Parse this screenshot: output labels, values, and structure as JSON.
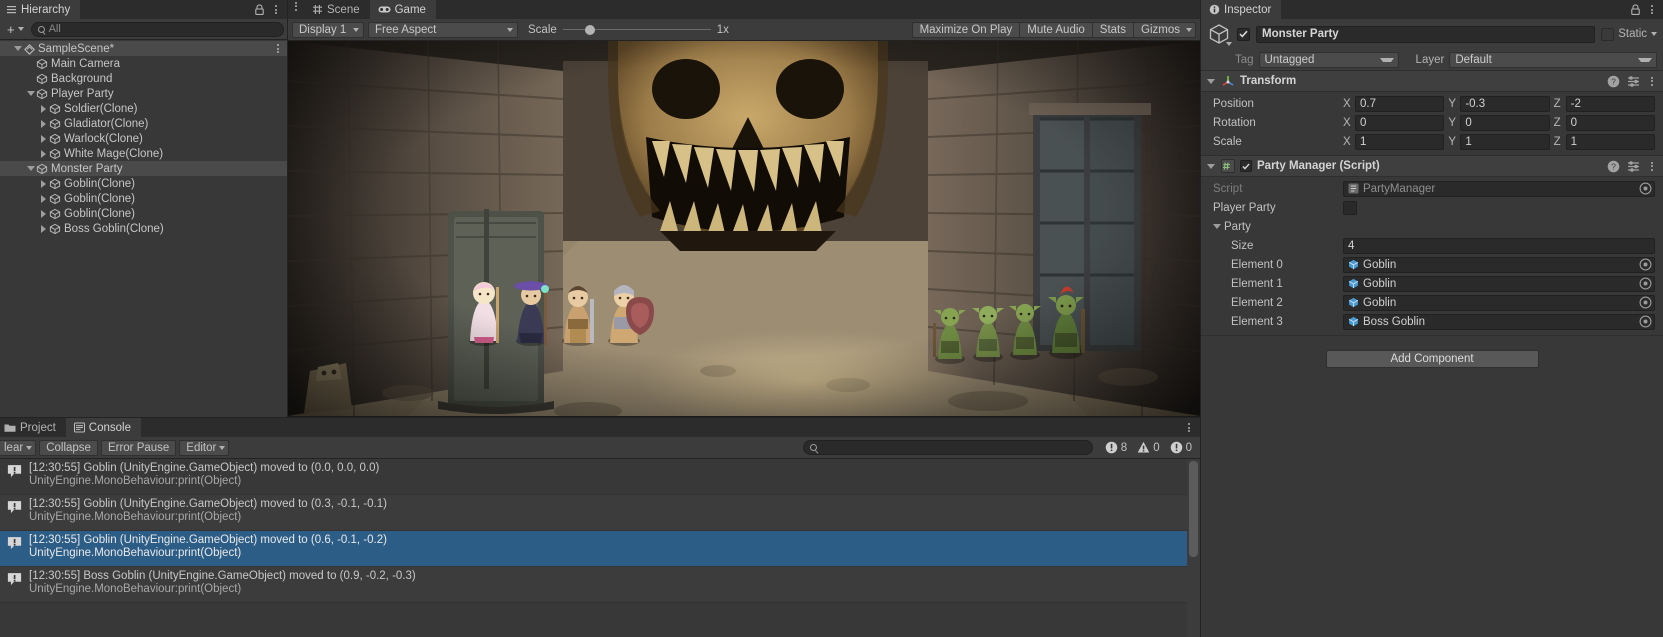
{
  "hierarchy": {
    "tab_label": "Hierarchy",
    "lock_icon": "lock-icon",
    "menu_icon": "kebab-menu-icon",
    "create_label": "+",
    "search_placeholder": "All",
    "search_value": "",
    "items": [
      {
        "label": "SampleScene*",
        "depth": 0,
        "icon": "unity-scene-icon",
        "expanded": true,
        "has_children": true,
        "selected": false,
        "has_menu": true
      },
      {
        "label": "Main Camera",
        "depth": 1,
        "icon": "gameobject-cube-icon",
        "expanded": null,
        "has_children": false,
        "selected": false,
        "has_menu": false
      },
      {
        "label": "Background",
        "depth": 1,
        "icon": "gameobject-cube-icon",
        "expanded": null,
        "has_children": false,
        "selected": false,
        "has_menu": false
      },
      {
        "label": "Player Party",
        "depth": 1,
        "icon": "gameobject-cube-icon",
        "expanded": true,
        "has_children": true,
        "selected": false,
        "has_menu": false
      },
      {
        "label": "Soldier(Clone)",
        "depth": 2,
        "icon": "gameobject-cube-icon",
        "expanded": false,
        "has_children": true,
        "selected": false,
        "has_menu": false
      },
      {
        "label": "Gladiator(Clone)",
        "depth": 2,
        "icon": "gameobject-cube-icon",
        "expanded": false,
        "has_children": true,
        "selected": false,
        "has_menu": false
      },
      {
        "label": "Warlock(Clone)",
        "depth": 2,
        "icon": "gameobject-cube-icon",
        "expanded": false,
        "has_children": true,
        "selected": false,
        "has_menu": false
      },
      {
        "label": "White Mage(Clone)",
        "depth": 2,
        "icon": "gameobject-cube-icon",
        "expanded": false,
        "has_children": true,
        "selected": false,
        "has_menu": false
      },
      {
        "label": "Monster Party",
        "depth": 1,
        "icon": "gameobject-cube-icon",
        "expanded": true,
        "has_children": true,
        "selected": true,
        "has_menu": false
      },
      {
        "label": "Goblin(Clone)",
        "depth": 2,
        "icon": "gameobject-cube-icon",
        "expanded": false,
        "has_children": true,
        "selected": false,
        "has_menu": false
      },
      {
        "label": "Goblin(Clone)",
        "depth": 2,
        "icon": "gameobject-cube-icon",
        "expanded": false,
        "has_children": true,
        "selected": false,
        "has_menu": false
      },
      {
        "label": "Goblin(Clone)",
        "depth": 2,
        "icon": "gameobject-cube-icon",
        "expanded": false,
        "has_children": true,
        "selected": false,
        "has_menu": false
      },
      {
        "label": "Boss Goblin(Clone)",
        "depth": 2,
        "icon": "gameobject-cube-icon",
        "expanded": false,
        "has_children": true,
        "selected": false,
        "has_menu": false
      }
    ]
  },
  "center": {
    "tabs": [
      {
        "label": "Scene",
        "icon": "scene-grid-icon",
        "active": false
      },
      {
        "label": "Game",
        "icon": "gamepad-icon",
        "active": true
      }
    ],
    "menu_icon": "kebab-menu-icon",
    "toolbar": {
      "display": "Display 1",
      "aspect": "Free Aspect",
      "scale_label": "Scale",
      "scale_value": "1x",
      "maximize_on_play": "Maximize On Play",
      "mute_audio": "Mute Audio",
      "stats": "Stats",
      "gizmos": "Gizmos"
    }
  },
  "inspector": {
    "tab_label": "Inspector",
    "info_icon": "info-icon",
    "lock_icon": "lock-icon",
    "menu_icon": "kebab-menu-icon",
    "object_name": "Monster Party",
    "enabled": true,
    "static_label": "Static",
    "tag_label": "Tag",
    "tag_value": "Untagged",
    "layer_label": "Layer",
    "layer_value": "Default",
    "transform": {
      "title": "Transform",
      "icon": "transform-axis-icon",
      "rows": [
        {
          "name": "Position",
          "x": "0.7",
          "y": "-0.3",
          "z": "-2"
        },
        {
          "name": "Rotation",
          "x": "0",
          "y": "0",
          "z": "0"
        },
        {
          "name": "Scale",
          "x": "1",
          "y": "1",
          "z": "1"
        }
      ],
      "axis_labels": [
        "X",
        "Y",
        "Z"
      ]
    },
    "party_manager": {
      "title": "Party Manager (Script)",
      "icon": "csharp-script-icon",
      "enabled": true,
      "script_label": "Script",
      "script_value": "PartyManager",
      "player_party_label": "Player Party",
      "player_party_value": "",
      "party_label": "Party",
      "size_label": "Size",
      "size_value": "4",
      "elements": [
        {
          "label": "Element 0",
          "value": "Goblin"
        },
        {
          "label": "Element 1",
          "value": "Goblin"
        },
        {
          "label": "Element 2",
          "value": "Goblin"
        },
        {
          "label": "Element 3",
          "value": "Boss Goblin"
        }
      ]
    },
    "add_component_label": "Add Component"
  },
  "console": {
    "tabs": [
      {
        "label": "Project",
        "icon": "folder-icon",
        "active": false
      },
      {
        "label": "Console",
        "icon": "console-icon",
        "active": true
      }
    ],
    "menu_icon": "kebab-menu-icon",
    "toolbar": {
      "clear_label": "lear",
      "collapse_label": "Collapse",
      "error_pause_label": "Error Pause",
      "editor_label": "Editor",
      "search_placeholder": "",
      "log_count": "8",
      "warning_count": "0",
      "error_count": "0"
    },
    "logs": [
      {
        "line1": "[12:30:55] Goblin (UnityEngine.GameObject) moved to (0.0, 0.0, 0.0)",
        "line2": "UnityEngine.MonoBehaviour:print(Object)",
        "type": "log",
        "selected": false
      },
      {
        "line1": "[12:30:55] Goblin (UnityEngine.GameObject) moved to (0.3, -0.1, -0.1)",
        "line2": "UnityEngine.MonoBehaviour:print(Object)",
        "type": "log",
        "selected": false
      },
      {
        "line1": "[12:30:55] Goblin (UnityEngine.GameObject) moved to (0.6, -0.1, -0.2)",
        "line2": "UnityEngine.MonoBehaviour:print(Object)",
        "type": "log",
        "selected": true
      },
      {
        "line1": "[12:30:55] Boss Goblin (UnityEngine.GameObject) moved to (0.9, -0.2, -0.3)",
        "line2": "UnityEngine.MonoBehaviour:print(Object)",
        "type": "log",
        "selected": false
      }
    ]
  },
  "colors": {
    "selection_blue": "#2c5d87",
    "panel_bg": "#383838",
    "toolbar_bg": "#3c3c3c",
    "tabbar_bg": "#2c2c2c",
    "field_bg": "#2a2a2a",
    "button_bg": "#4b4b4b",
    "row_selected": "#4a4a4a",
    "object_field_icon": "#4a9ad4"
  }
}
